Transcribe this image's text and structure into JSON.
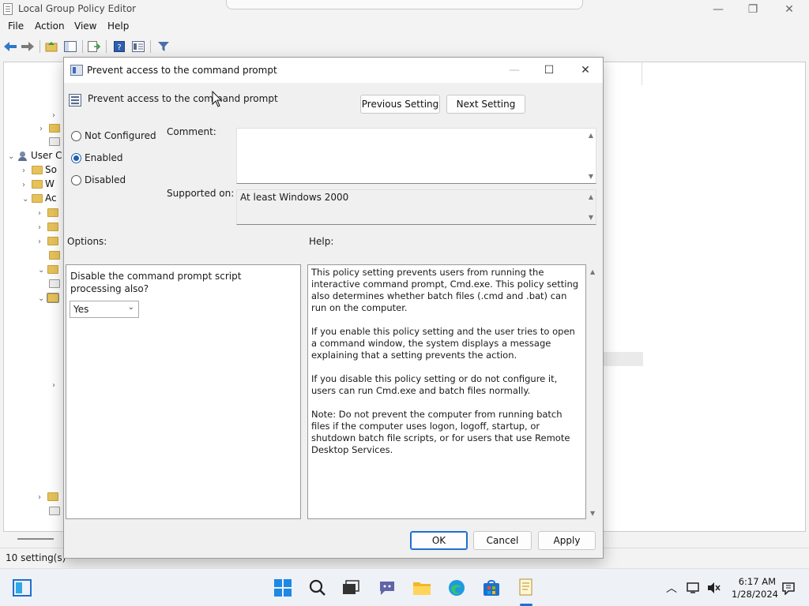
{
  "window": {
    "title": "Local Group Policy Editor",
    "minimize": "—",
    "maximize": "❐",
    "close": "✕"
  },
  "menu": {
    "items": [
      "File",
      "Action",
      "View",
      "Help"
    ]
  },
  "toolbar": {
    "icons": [
      "back-arrow-icon",
      "forward-arrow-icon",
      "up-folder-icon",
      "show-hide-tree-icon",
      "export-list-icon",
      "help-icon",
      "properties-icon",
      "filter-icon"
    ]
  },
  "tree": {
    "items": [
      {
        "label": "",
        "arrow": "›"
      },
      {
        "label": "",
        "arrow": "›"
      },
      {
        "label": "",
        "arrow": ""
      },
      {
        "label": "User C",
        "arrow": "⌄"
      },
      {
        "label": "So",
        "arrow": "›"
      },
      {
        "label": "W",
        "arrow": "›"
      },
      {
        "label": "Ac",
        "arrow": "⌄"
      }
    ]
  },
  "status": {
    "text": "10 setting(s)"
  },
  "dialog": {
    "title": "Prevent access to the command prompt",
    "policy_name": "Prevent access to the command prompt",
    "minimize": "—",
    "maximize": "☐",
    "close": "✕",
    "prev_button": "Previous Setting",
    "next_button": "Next Setting",
    "radio_not_configured": "Not Configured",
    "radio_enabled": "Enabled",
    "radio_disabled": "Disabled",
    "selected_state": "Enabled",
    "comment_label": "Comment:",
    "comment_value": "",
    "supported_label": "Supported on:",
    "supported_value": "At least Windows 2000",
    "options_label": "Options:",
    "help_label": "Help:",
    "option_text": "Disable the command prompt script processing also?",
    "option_select_value": "Yes",
    "help_paragraphs": [
      "This policy setting prevents users from running the interactive command prompt, Cmd.exe.  This policy setting also determines whether batch files (.cmd and .bat) can run on the computer.",
      "If you enable this policy setting and the user tries to open a command window, the system displays a message explaining that a setting prevents the action.",
      "If you disable this policy setting or do not configure it, users can run Cmd.exe and batch files normally.",
      "Note: Do not prevent the computer from running batch files if the computer uses logon, logoff, startup, or shutdown batch file scripts, or for users that use Remote Desktop Services."
    ],
    "ok_button": "OK",
    "cancel_button": "Cancel",
    "apply_button": "Apply"
  },
  "taskbar": {
    "time": "6:17 AM",
    "date": "1/28/2024",
    "chevron": "︿"
  },
  "colors": {
    "accent": "#1e6fd0",
    "folder": "#e6c25a",
    "taskbar": "#eef1f6"
  }
}
